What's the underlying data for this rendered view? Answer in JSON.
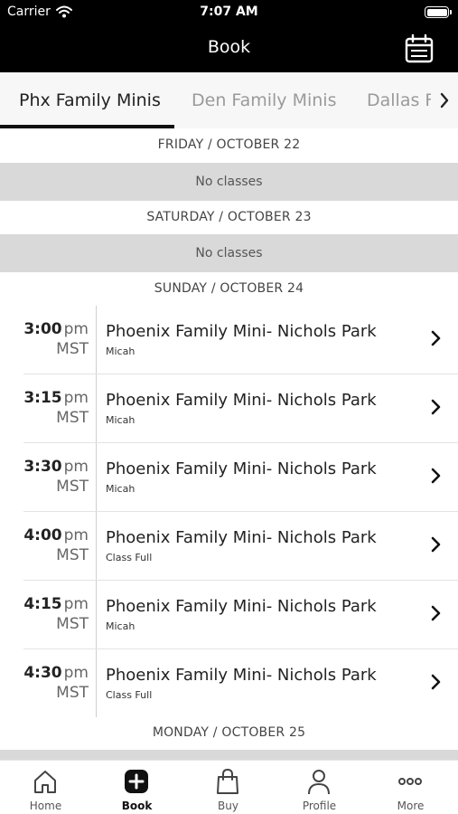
{
  "status_bar": {
    "carrier": "Carrier",
    "time": "7:07 AM"
  },
  "nav": {
    "title": "Book",
    "calendar_icon": "calendar-icon"
  },
  "tabs": [
    {
      "label": "Phx Family Minis",
      "active": true
    },
    {
      "label": "Den Family Minis",
      "active": false
    },
    {
      "label": "Dallas Family Minis",
      "active": false
    }
  ],
  "schedule": {
    "days": [
      {
        "header": "FRIDAY / OCTOBER 22",
        "empty_text": "No classes"
      },
      {
        "header": "SATURDAY / OCTOBER 23",
        "empty_text": "No classes"
      },
      {
        "header": "SUNDAY / OCTOBER 24"
      },
      {
        "header": "MONDAY / OCTOBER 25"
      }
    ],
    "classes": [
      {
        "time": "3:00",
        "ampm": "pm",
        "tz": "MST",
        "name": "Phoenix Family Mini- Nichols Park",
        "sub": "Micah"
      },
      {
        "time": "3:15",
        "ampm": "pm",
        "tz": "MST",
        "name": "Phoenix Family Mini- Nichols Park",
        "sub": "Micah"
      },
      {
        "time": "3:30",
        "ampm": "pm",
        "tz": "MST",
        "name": "Phoenix Family Mini- Nichols Park",
        "sub": "Micah"
      },
      {
        "time": "4:00",
        "ampm": "pm",
        "tz": "MST",
        "name": "Phoenix Family Mini- Nichols Park",
        "sub": "Class Full"
      },
      {
        "time": "4:15",
        "ampm": "pm",
        "tz": "MST",
        "name": "Phoenix Family Mini- Nichols Park",
        "sub": "Micah"
      },
      {
        "time": "4:30",
        "ampm": "pm",
        "tz": "MST",
        "name": "Phoenix Family Mini- Nichols Park",
        "sub": "Class Full"
      }
    ]
  },
  "tab_bar": [
    {
      "label": "Home",
      "icon": "home-icon",
      "active": false
    },
    {
      "label": "Book",
      "icon": "book-plus-icon",
      "active": true
    },
    {
      "label": "Buy",
      "icon": "shopping-bag-icon",
      "active": false
    },
    {
      "label": "Profile",
      "icon": "person-icon",
      "active": false
    },
    {
      "label": "More",
      "icon": "more-dots-icon",
      "active": false
    }
  ]
}
